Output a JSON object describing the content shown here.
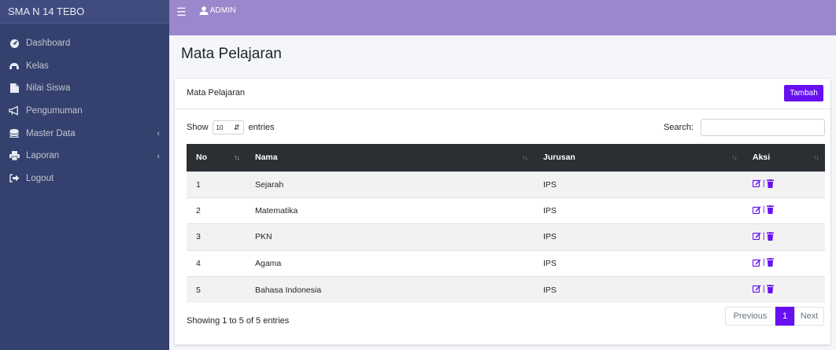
{
  "brand": "SMA N 14 TEBO",
  "sidebar": {
    "items": [
      {
        "label": "Dashboard",
        "icon": "tachometer-icon"
      },
      {
        "label": "Kelas",
        "icon": "door-icon"
      },
      {
        "label": "Nilai Siswa",
        "icon": "file-icon"
      },
      {
        "label": "Pengumuman",
        "icon": "bullhorn-icon"
      },
      {
        "label": "Master Data",
        "icon": "database-icon"
      },
      {
        "label": "Laporan",
        "icon": "print-icon"
      },
      {
        "label": "Logout",
        "icon": "sign-out-icon"
      }
    ]
  },
  "topbar": {
    "user": "ADMIN"
  },
  "page": {
    "title": "Mata Pelajaran"
  },
  "card": {
    "title": "Mata Pelajaran",
    "add_label": "Tambah"
  },
  "datatable": {
    "show_label": "Show",
    "length_value": "10",
    "entries_label": "entries",
    "search_label": "Search:",
    "search_value": "",
    "columns": [
      "No",
      "Nama",
      "Jurusan",
      "Aksi"
    ],
    "rows": [
      {
        "no": "1",
        "nama": "Sejarah",
        "jurusan": "IPS"
      },
      {
        "no": "2",
        "nama": "Matematika",
        "jurusan": "IPS"
      },
      {
        "no": "3",
        "nama": "PKN",
        "jurusan": "IPS"
      },
      {
        "no": "4",
        "nama": "Agama",
        "jurusan": "IPS"
      },
      {
        "no": "5",
        "nama": "Bahasa Indonesia",
        "jurusan": "IPS"
      }
    ],
    "action_separator": "|",
    "info": "Showing 1 to 5 of 5 entries",
    "pagination": {
      "previous": "Previous",
      "current": "1",
      "next": "Next"
    }
  },
  "colors": {
    "sidebar": "#34406d",
    "topbar": "#9b87cc",
    "accent": "#6610f2",
    "table_header": "#2b2f33"
  }
}
